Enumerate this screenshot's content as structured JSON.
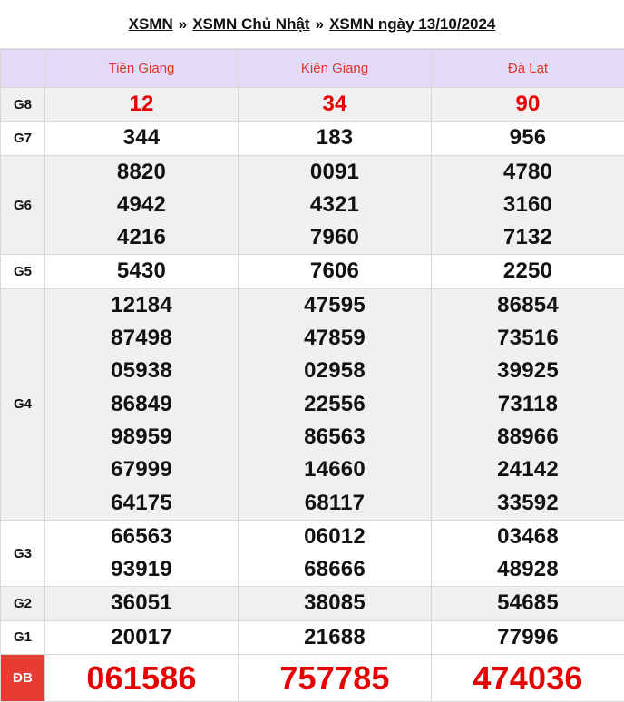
{
  "breadcrumb": {
    "items": [
      "XSMN",
      "XSMN Chủ Nhật",
      "XSMN ngày 13/10/2024"
    ],
    "separator": "»"
  },
  "provinces": [
    "Tiền Giang",
    "Kiên Giang",
    "Đà Lạt"
  ],
  "prizes": [
    {
      "label": "G8",
      "values": [
        [
          "12"
        ],
        [
          "34"
        ],
        [
          "90"
        ]
      ]
    },
    {
      "label": "G7",
      "values": [
        [
          "344"
        ],
        [
          "183"
        ],
        [
          "956"
        ]
      ]
    },
    {
      "label": "G6",
      "values": [
        [
          "8820",
          "4942",
          "4216"
        ],
        [
          "0091",
          "4321",
          "7960"
        ],
        [
          "4780",
          "3160",
          "7132"
        ]
      ]
    },
    {
      "label": "G5",
      "values": [
        [
          "5430"
        ],
        [
          "7606"
        ],
        [
          "2250"
        ]
      ]
    },
    {
      "label": "G4",
      "values": [
        [
          "12184",
          "87498",
          "05938",
          "86849",
          "98959",
          "67999",
          "64175"
        ],
        [
          "47595",
          "47859",
          "02958",
          "22556",
          "86563",
          "14660",
          "68117"
        ],
        [
          "86854",
          "73516",
          "39925",
          "73118",
          "88966",
          "24142",
          "33592"
        ]
      ]
    },
    {
      "label": "G3",
      "values": [
        [
          "66563",
          "93919"
        ],
        [
          "06012",
          "68666"
        ],
        [
          "03468",
          "48928"
        ]
      ]
    },
    {
      "label": "G2",
      "values": [
        [
          "36051"
        ],
        [
          "38085"
        ],
        [
          "54685"
        ]
      ]
    },
    {
      "label": "G1",
      "values": [
        [
          "20017"
        ],
        [
          "21688"
        ],
        [
          "77996"
        ]
      ]
    },
    {
      "label": "ĐB",
      "values": [
        [
          "061586"
        ],
        [
          "757785"
        ],
        [
          "474036"
        ]
      ]
    }
  ],
  "colors": {
    "header_bg": "#e2daf6",
    "province_text": "#e0352b",
    "highlight_number": "#e60000",
    "special_label_bg": "#e73b33",
    "shaded_row": "#f0f0f0"
  }
}
